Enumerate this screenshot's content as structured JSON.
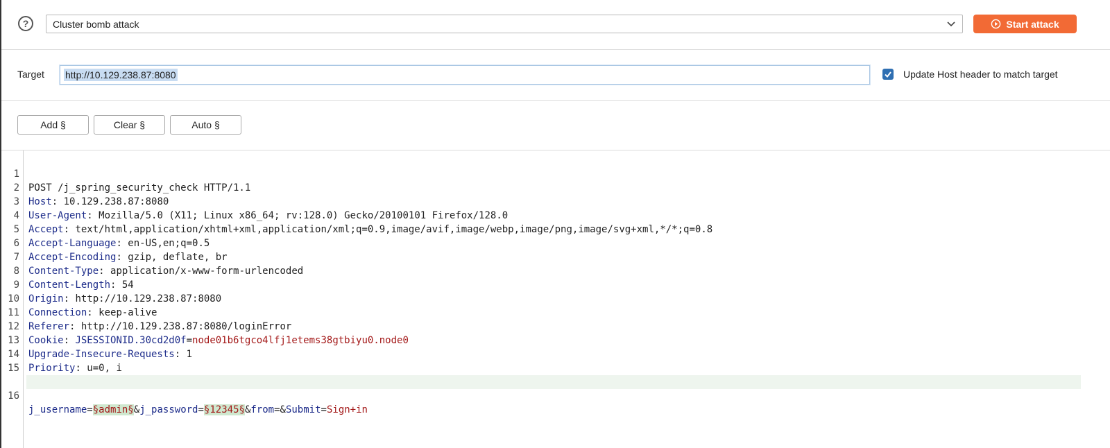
{
  "topbar": {
    "help_icon": "question-circle-icon",
    "attack_type": "Cluster bomb attack",
    "start_button_label": "Start attack"
  },
  "target": {
    "label": "Target",
    "value": "http://10.129.238.87:8080",
    "update_host_checked": true,
    "update_host_label": "Update Host header to match target"
  },
  "payload_buttons": {
    "add_label": "Add §",
    "clear_label": "Clear §",
    "auto_label": "Auto §"
  },
  "request": {
    "line_numbers": [
      "1",
      "2",
      "3",
      "4",
      "5",
      "6",
      "7",
      "8",
      "9",
      "10",
      "11",
      "12",
      "13",
      "14",
      "15",
      "16"
    ],
    "request_line": "POST /j_spring_security_check HTTP/1.1",
    "headers": [
      {
        "name": "Host",
        "value": " 10.129.238.87:8080"
      },
      {
        "name": "User-Agent",
        "value": " Mozilla/5.0 (X11; Linux x86_64; rv:128.0) Gecko/20100101 Firefox/128.0"
      },
      {
        "name": "Accept",
        "value": " text/html,application/xhtml+xml,application/xml;q=0.9,image/avif,image/webp,image/png,image/svg+xml,*/*;q=0.8"
      },
      {
        "name": "Accept-Language",
        "value": " en-US,en;q=0.5"
      },
      {
        "name": "Accept-Encoding",
        "value": " gzip, deflate, br"
      },
      {
        "name": "Content-Type",
        "value": " application/x-www-form-urlencoded"
      },
      {
        "name": "Content-Length",
        "value": " 54"
      },
      {
        "name": "Origin",
        "value": " http://10.129.238.87:8080"
      },
      {
        "name": "Connection",
        "value": " keep-alive"
      },
      {
        "name": "Referer",
        "value": " http://10.129.238.87:8080/loginError"
      }
    ],
    "cookie_name": "Cookie",
    "cookie_key": " JSESSIONID.30cd2d0f",
    "cookie_value": "node01b6tgco4lfj1etems38gtbiyu0.node0",
    "headers_after": [
      {
        "name": "Upgrade-Insecure-Requests",
        "value": " 1"
      },
      {
        "name": "Priority",
        "value": " u=0, i"
      }
    ],
    "body": {
      "p1_name": "j_username",
      "p1_marker": "§admin§",
      "p2_name": "j_password",
      "p2_marker": "§12345§",
      "p3_name": "from",
      "p4_name": "Submit",
      "p4_value": "Sign+in"
    }
  },
  "colors": {
    "accent": "#f26a35",
    "checkbox": "#2f6fb2",
    "header_name": "#1d2c8a",
    "value_red": "#a31818",
    "payload_marker_bg": "#cfe8cf"
  }
}
